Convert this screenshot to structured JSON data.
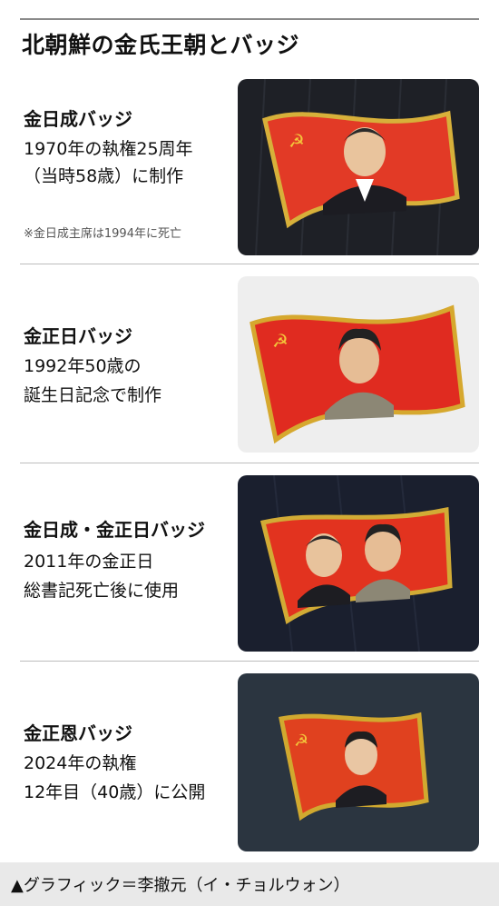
{
  "title": "北朝鮮の金氏王朝とバッジ",
  "badges": [
    {
      "name": "金日成バッジ",
      "line1": "1970年の執権25周年",
      "line2": "（当時58歳）に制作",
      "note": "※金日成主席は1994年に死亡",
      "bg": "#1e2026",
      "flag": "#e23a26"
    },
    {
      "name": "金正日バッジ",
      "line1": "1992年50歳の",
      "line2": "誕生日記念で制作",
      "note": "",
      "bg": "#eeeeee",
      "flag": "#e02b20"
    },
    {
      "name": "金日成・金正日バッジ",
      "line1": "2011年の金正日",
      "line2": "総書記死亡後に使用",
      "note": "",
      "bg": "#1a1f2e",
      "flag": "#e2331f"
    },
    {
      "name": "金正恩バッジ",
      "line1": "2024年の執権",
      "line2": "12年目（40歳）に公開",
      "note": "",
      "bg": "#2b3540",
      "flag": "#e0411f"
    }
  ],
  "footer": "▲グラフィック＝李撤元（イ・チョルウォン）"
}
